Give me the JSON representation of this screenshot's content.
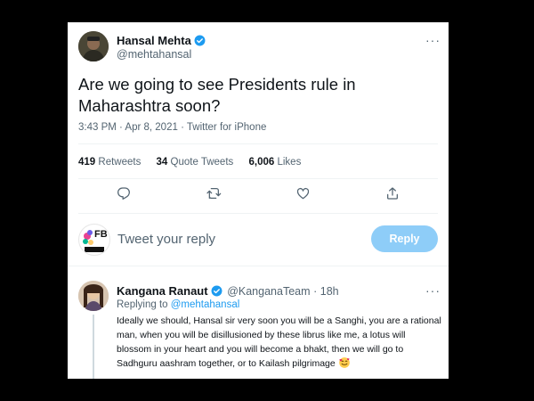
{
  "tweet": {
    "author_name": "Hansal Mehta",
    "author_handle": "@mehtahansal",
    "text": "Are we going to see Presidents rule in Maharashtra soon?",
    "timestamp": "3:43 PM · Apr 8, 2021 · Twitter for iPhone",
    "stats": {
      "retweets_count": "419",
      "retweets_label": "Retweets",
      "quotes_count": "34",
      "quotes_label": "Quote Tweets",
      "likes_count": "6,006",
      "likes_label": "Likes"
    }
  },
  "composer": {
    "placeholder": "Tweet your reply",
    "reply_button": "Reply",
    "avatar_text": "FB"
  },
  "reply": {
    "author_name": "Kangana Ranaut",
    "author_handle": "@KanganaTeam",
    "time": "· 18h",
    "replying_prefix": "Replying to",
    "replying_to": "@mehtahansal",
    "text": "Ideally we should, Hansal sir very soon you will be a Sanghi, you are a rational man, when you will be disillusioned by these librus like me, a lotus will blossom in your heart and you will become a bhakt, then we will go to Sadhguru aashram together, or to Kailash pilgrimage"
  },
  "more_label": "···",
  "colors": {
    "accent": "#1d9bf0",
    "reply_button_disabled": "#8ecdf8",
    "secondary_text": "#536471"
  }
}
